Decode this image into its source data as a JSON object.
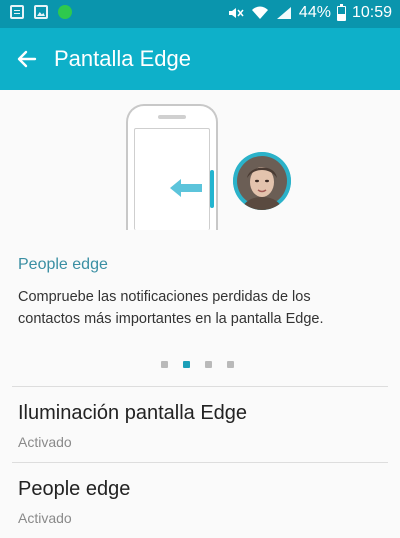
{
  "status_bar": {
    "battery_percent": "44%",
    "battery_level": 0.44,
    "time": "10:59",
    "icons": [
      "document-icon",
      "image-icon",
      "chat-app-icon",
      "mute-icon",
      "wifi-icon",
      "signal-icon",
      "battery-icon"
    ],
    "colors": {
      "background": "#0a95ad",
      "chat_icon": "#2ec94e"
    }
  },
  "app_bar": {
    "title": "Pantalla Edge",
    "back_icon": "arrow-left-icon",
    "color": "#0eb0c9"
  },
  "illustration": {
    "icons": [
      "phone-outline-icon",
      "swipe-left-arrow-icon",
      "contact-avatar-icon"
    ],
    "accent": "#23b4cf"
  },
  "feature": {
    "title": "People edge",
    "description": "Compruebe las notificaciones perdidas de los contactos más importantes en la pantalla Edge."
  },
  "pager": {
    "count": 4,
    "active_index": 1
  },
  "settings": [
    {
      "title": "Iluminación pantalla Edge",
      "subtitle": "Activado"
    },
    {
      "title": "People edge",
      "subtitle": "Activado"
    }
  ]
}
